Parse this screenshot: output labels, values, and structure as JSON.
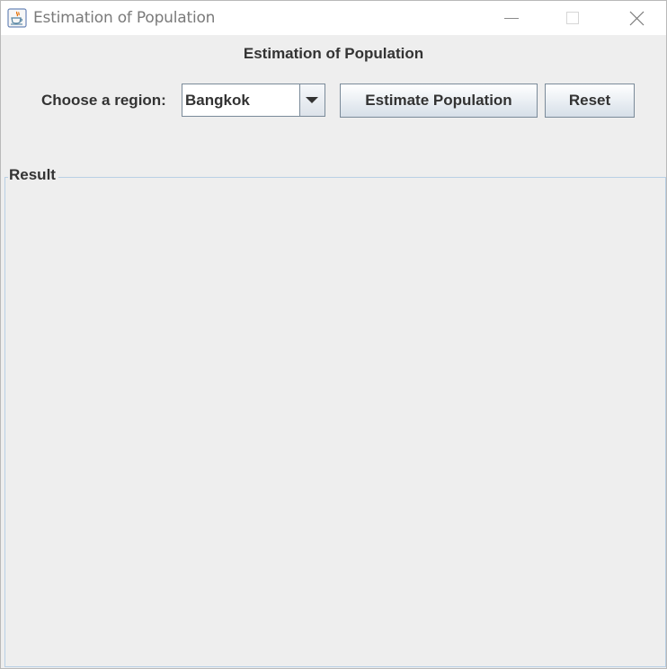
{
  "window": {
    "title": "Estimation of Population",
    "icon": "java-cup-icon"
  },
  "heading": "Estimation of Population",
  "region": {
    "label": "Choose a region:",
    "selected": "Bangkok"
  },
  "buttons": {
    "estimate_label": "Estimate Population",
    "reset_label": "Reset"
  },
  "result": {
    "title": "Result"
  }
}
